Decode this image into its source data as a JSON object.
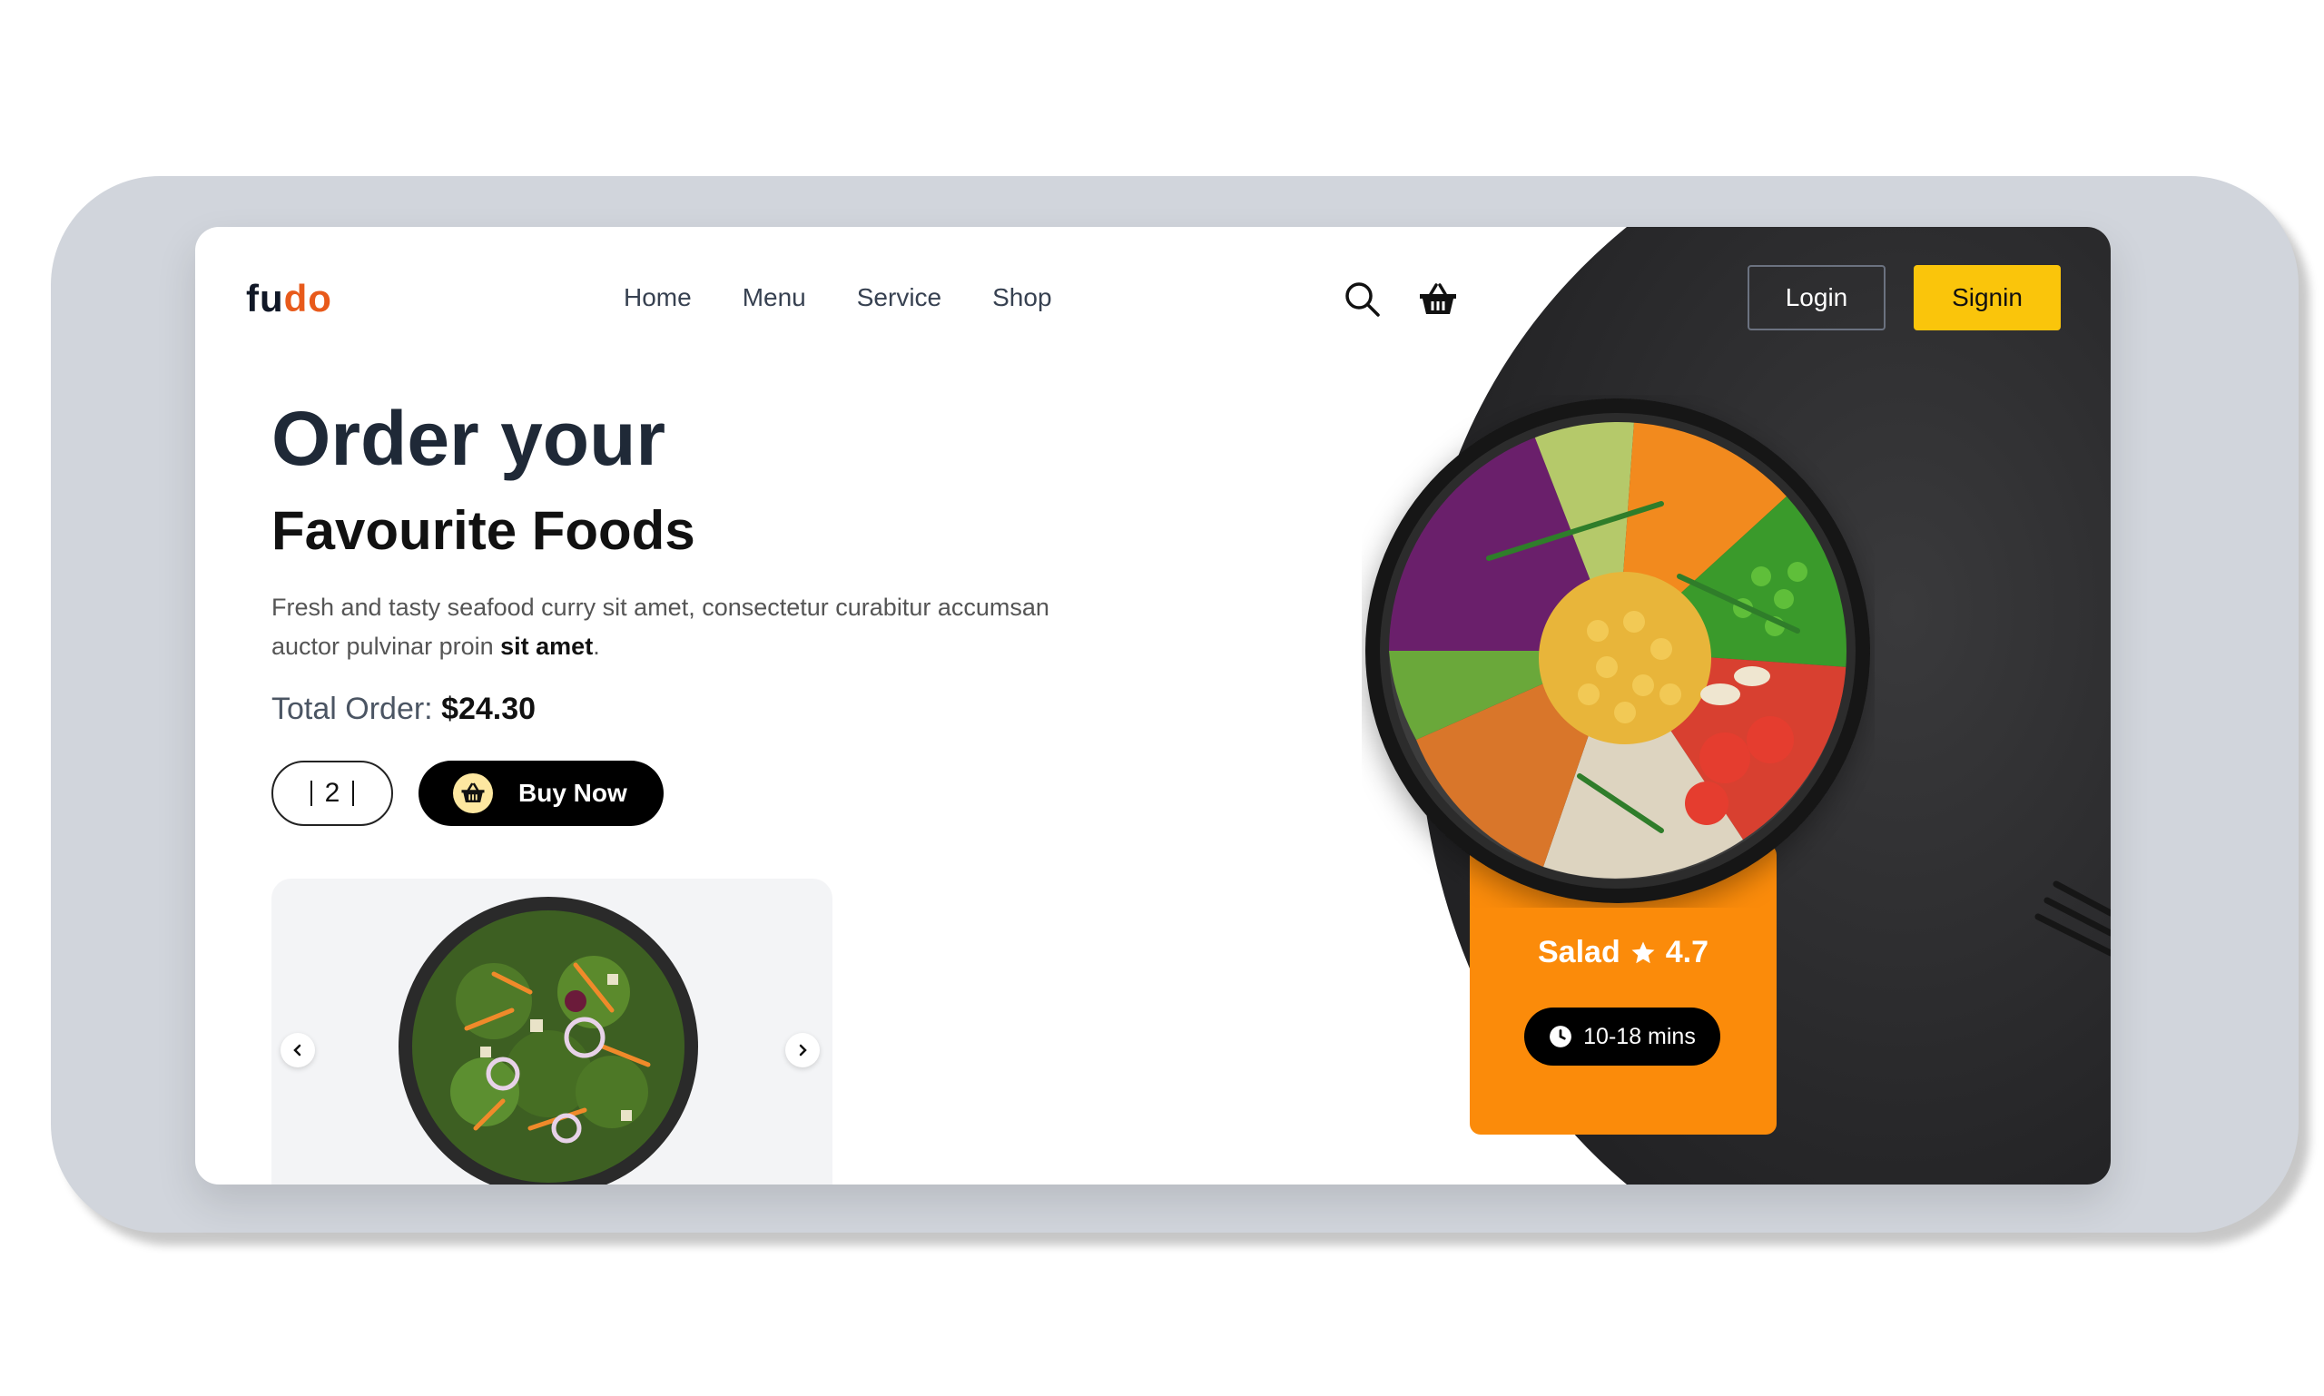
{
  "brand": {
    "part1": "fu",
    "part2": "do"
  },
  "nav": {
    "items": [
      {
        "label": "Home"
      },
      {
        "label": "Menu"
      },
      {
        "label": "Service"
      },
      {
        "label": "Shop"
      }
    ]
  },
  "header": {
    "icons": [
      "search-icon",
      "basket-icon"
    ],
    "login_label": "Login",
    "signin_label": "Signin"
  },
  "hero": {
    "title": "Order your",
    "subtitle": "Favourite Foods",
    "description": "Fresh and tasty seafood curry sit amet, consectetur curabitur accumsan auctor pulvinar proin ",
    "description_bold": "sit amet",
    "description_end": ".",
    "total_label": "Total Order: ",
    "total_value": "$24.30",
    "quantity": "2",
    "buy_label": "Buy Now"
  },
  "featured": {
    "name": "Salad",
    "rating": "4.7",
    "time": "10-18 mins"
  },
  "colors": {
    "accent_yellow": "#fac50b",
    "accent_orange": "#fb8b0a",
    "brand_orange": "#e85a1b",
    "dark_bg": "#2a2a2c"
  }
}
